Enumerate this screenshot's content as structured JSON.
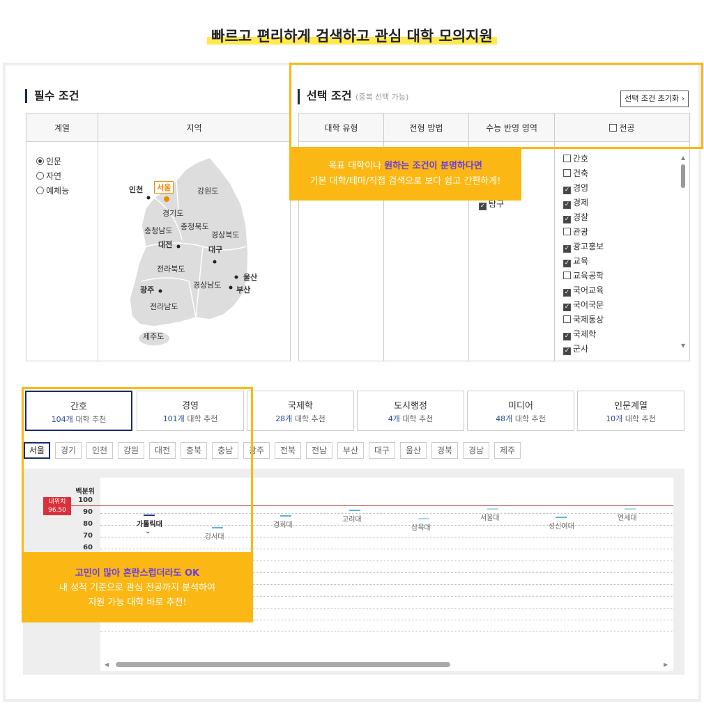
{
  "headline": "빠르고 편리하게 검색하고 관심 대학 모의지원",
  "required": {
    "title": "필수 조건",
    "col_field": "계열",
    "col_region": "지역",
    "fields": [
      {
        "label": "인문",
        "selected": true
      },
      {
        "label": "자연",
        "selected": false
      },
      {
        "label": "예체능",
        "selected": false
      }
    ],
    "map_labels": {
      "incheon": "인천",
      "seoul": "서울",
      "gangwon": "강원도",
      "gyeonggi": "경기도",
      "chungbuk": "충청북도",
      "chungnam": "충청남도",
      "gyeongbuk": "경상북도",
      "daejeon": "대전",
      "daegu": "대구",
      "jeonbuk": "전라북도",
      "ulsan": "울산",
      "gwangju": "광주",
      "gyeongnam": "경상남도",
      "busan": "부산",
      "jeonnam": "전라남도",
      "jeju": "제주도"
    }
  },
  "selection": {
    "title": "선택 조건",
    "subtitle": "(중복 선택 가능)",
    "reset_label": "선택 조건 초기화",
    "cols": [
      "대학 유형",
      "전형 방법",
      "수능 반영 영역",
      "전공"
    ],
    "partial_item": "탐구",
    "majors": [
      {
        "label": "간호",
        "checked": false
      },
      {
        "label": "건축",
        "checked": false
      },
      {
        "label": "경영",
        "checked": true
      },
      {
        "label": "경제",
        "checked": true
      },
      {
        "label": "경찰",
        "checked": true
      },
      {
        "label": "관광",
        "checked": false
      },
      {
        "label": "광고홍보",
        "checked": true
      },
      {
        "label": "교육",
        "checked": true
      },
      {
        "label": "교육공학",
        "checked": false
      },
      {
        "label": "국어교육",
        "checked": true
      },
      {
        "label": "국어국문",
        "checked": true
      },
      {
        "label": "국제통상",
        "checked": false
      },
      {
        "label": "국제학",
        "checked": true
      },
      {
        "label": "군사",
        "checked": true
      }
    ]
  },
  "callout_top": {
    "line1_pre": "목표 대학이나 ",
    "line1_hl": "원하는 조건이 분명하다면",
    "line2": "기본 대학/테마/직접 검색으로 보다 쉽고 간편하게!"
  },
  "callout_bottom": {
    "line1": "고민이 많아 혼란스럽더라도 OK",
    "line2": "내 성적 기준으로 관심 전공까지 분석하여",
    "line3": "지원 가능 대학 바로 추천!"
  },
  "tabs": [
    {
      "name": "간호",
      "count": "104개",
      "suffix": "대학 추천"
    },
    {
      "name": "경영",
      "count": "101개",
      "suffix": "대학 추천"
    },
    {
      "name": "국제학",
      "count": "28개",
      "suffix": "대학 추천"
    },
    {
      "name": "도시행정",
      "count": "4개",
      "suffix": "대학 추천"
    },
    {
      "name": "미디어",
      "count": "48개",
      "suffix": "대학 추천"
    },
    {
      "name": "인문계열",
      "count": "10개",
      "suffix": "대학 추천"
    }
  ],
  "regions": [
    "서울",
    "경기",
    "인천",
    "강원",
    "대전",
    "충북",
    "충남",
    "광주",
    "전북",
    "전남",
    "부산",
    "대구",
    "울산",
    "경북",
    "경남",
    "제주"
  ],
  "chart_data": {
    "type": "scatter",
    "ylabel": "백분위",
    "yticks": [
      100,
      90,
      80,
      70,
      60
    ],
    "my_score_label": "내위치",
    "my_score": "96.50",
    "my_score_value": 96.5,
    "universities": [
      {
        "name": "가톨릭대",
        "value": 89,
        "color": "#1a3a8a"
      },
      {
        "name": "강서대",
        "value": 78,
        "color": "#5ab4d8"
      },
      {
        "name": "경희대",
        "value": 88,
        "color": "#5ab4d8"
      },
      {
        "name": "고려대",
        "value": 93,
        "color": "#5ab4d8"
      },
      {
        "name": "삼육대",
        "value": 86,
        "color": "#a8d8e8"
      },
      {
        "name": "서울대",
        "value": 94,
        "color": "#a8d8e8"
      },
      {
        "name": "성신여대",
        "value": 87,
        "color": "#5ab4d8"
      },
      {
        "name": "연세대",
        "value": 94,
        "color": "#a8d8e8"
      }
    ]
  }
}
